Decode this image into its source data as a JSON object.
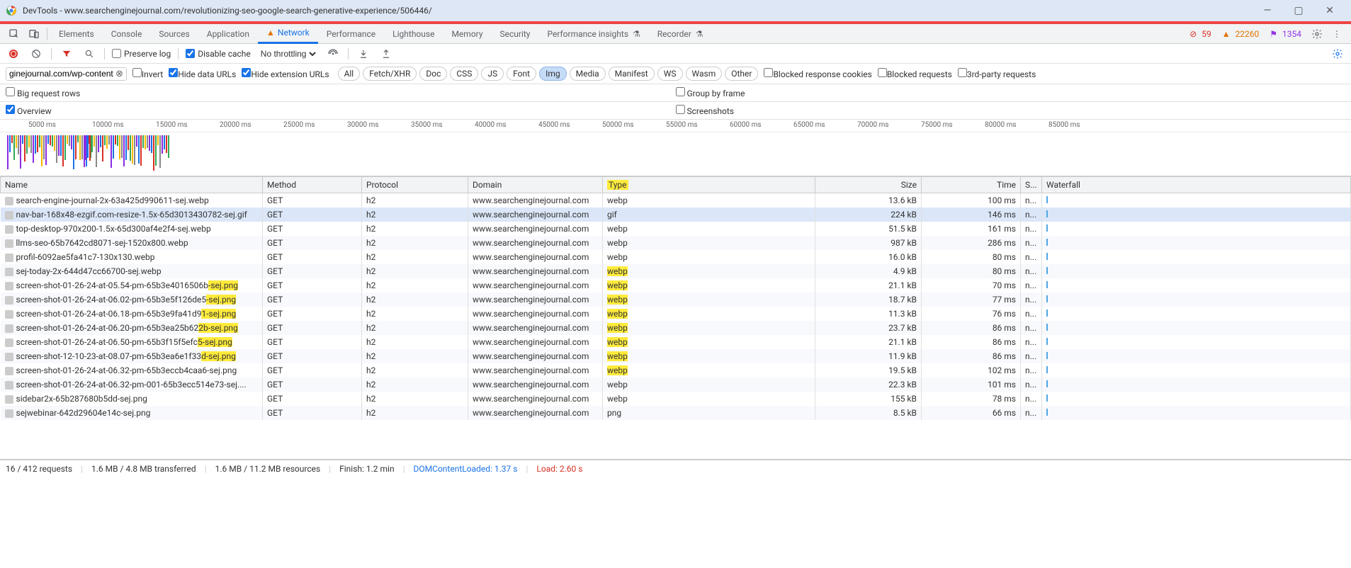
{
  "window": {
    "title": "DevTools - www.searchenginejournal.com/revolutionizing-seo-google-search-generative-experience/506446/"
  },
  "mainTabs": {
    "items": [
      "Elements",
      "Console",
      "Sources",
      "Application",
      "Network",
      "Performance",
      "Lighthouse",
      "Memory",
      "Security",
      "Performance insights",
      "Recorder"
    ],
    "active": "Network",
    "networkWarn": true
  },
  "counters": {
    "errors": "59",
    "warnings": "22260",
    "purple": "1354"
  },
  "toolbar": {
    "preserveLog": "Preserve log",
    "disableCache": "Disable cache",
    "throttling": "No throttling"
  },
  "filter": {
    "value": "ginejournal.com/wp-content",
    "invert": "Invert",
    "hideDataUrls": "Hide data URLs",
    "hideExtUrls": "Hide extension URLs",
    "types": [
      "All",
      "Fetch/XHR",
      "Doc",
      "CSS",
      "JS",
      "Font",
      "Img",
      "Media",
      "Manifest",
      "WS",
      "Wasm",
      "Other"
    ],
    "activeTypes": [
      "Img"
    ],
    "blockedCookies": "Blocked response cookies",
    "blockedRequests": "Blocked requests",
    "thirdParty": "3rd-party requests"
  },
  "options": {
    "bigRows": "Big request rows",
    "overview": "Overview",
    "groupFrame": "Group by frame",
    "screenshots": "Screenshots"
  },
  "timeline": {
    "ticks": [
      "5000 ms",
      "10000 ms",
      "15000 ms",
      "20000 ms",
      "25000 ms",
      "30000 ms",
      "35000 ms",
      "40000 ms",
      "45000 ms",
      "50000 ms",
      "55000 ms",
      "60000 ms",
      "65000 ms",
      "70000 ms",
      "75000 ms",
      "80000 ms",
      "85000 ms"
    ]
  },
  "columns": [
    "Name",
    "Method",
    "Protocol",
    "Domain",
    "Type",
    "Size",
    "Time",
    "S...",
    "Waterfall"
  ],
  "colHighlight": "Type",
  "rows": [
    {
      "name": "search-engine-journal-2x-63a425d990611-sej.webp",
      "method": "GET",
      "protocol": "h2",
      "domain": "www.searchenginejournal.com",
      "type": "webp",
      "size": "13.6 kB",
      "time": "100 ms",
      "status": "n...",
      "nameHl": "",
      "typeHl": false,
      "sel": false
    },
    {
      "name": "nav-bar-168x48-ezgif.com-resize-1.5x-65d3013430782-sej.gif",
      "method": "GET",
      "protocol": "h2",
      "domain": "www.searchenginejournal.com",
      "type": "gif",
      "size": "224 kB",
      "time": "146 ms",
      "status": "n...",
      "nameHl": "",
      "typeHl": false,
      "sel": true
    },
    {
      "name": "top-desktop-970x200-1.5x-65d300af4e2f4-sej.webp",
      "method": "GET",
      "protocol": "h2",
      "domain": "www.searchenginejournal.com",
      "type": "webp",
      "size": "51.5 kB",
      "time": "161 ms",
      "status": "n...",
      "nameHl": "",
      "typeHl": false,
      "sel": false
    },
    {
      "name": "llms-seo-65b7642cd8071-sej-1520x800.webp",
      "method": "GET",
      "protocol": "h2",
      "domain": "www.searchenginejournal.com",
      "type": "webp",
      "size": "987 kB",
      "time": "286 ms",
      "status": "n...",
      "nameHl": "",
      "typeHl": false,
      "sel": false
    },
    {
      "name": "profil-6092ae5fa41c7-130x130.webp",
      "method": "GET",
      "protocol": "h2",
      "domain": "www.searchenginejournal.com",
      "type": "webp",
      "size": "16.0 kB",
      "time": "80 ms",
      "status": "n...",
      "nameHl": "",
      "typeHl": false,
      "sel": false
    },
    {
      "name": "sej-today-2x-644d47cc66700-sej.webp",
      "method": "GET",
      "protocol": "h2",
      "domain": "www.searchenginejournal.com",
      "type": "webp",
      "size": "4.9 kB",
      "time": "80 ms",
      "status": "n...",
      "nameHl": "",
      "typeHl": true,
      "sel": false
    },
    {
      "name": "screen-shot-01-26-24-at-05.54-pm-65b3e4016506b",
      "nameHlSuffix": "-sej.png",
      "method": "GET",
      "protocol": "h2",
      "domain": "www.searchenginejournal.com",
      "type": "webp",
      "size": "21.1 kB",
      "time": "70 ms",
      "status": "n...",
      "typeHl": true,
      "sel": false
    },
    {
      "name": "screen-shot-01-26-24-at-06.02-pm-65b3e5f126de5",
      "nameHlSuffix": "-sej.png",
      "method": "GET",
      "protocol": "h2",
      "domain": "www.searchenginejournal.com",
      "type": "webp",
      "size": "18.7 kB",
      "time": "77 ms",
      "status": "n...",
      "typeHl": true,
      "sel": false
    },
    {
      "name": "screen-shot-01-26-24-at-06.18-pm-65b3e9fa41d9",
      "nameHlSuffix": "1-sej.png",
      "method": "GET",
      "protocol": "h2",
      "domain": "www.searchenginejournal.com",
      "type": "webp",
      "size": "11.3 kB",
      "time": "76 ms",
      "status": "n...",
      "typeHl": true,
      "sel": false
    },
    {
      "name": "screen-shot-01-26-24-at-06.20-pm-65b3ea25b62",
      "nameHlSuffix": "2b-sej.png",
      "method": "GET",
      "protocol": "h2",
      "domain": "www.searchenginejournal.com",
      "type": "webp",
      "size": "23.7 kB",
      "time": "86 ms",
      "status": "n...",
      "typeHl": true,
      "sel": false
    },
    {
      "name": "screen-shot-01-26-24-at-06.50-pm-65b3f15f5efc",
      "nameHlSuffix": "5-sej.png",
      "method": "GET",
      "protocol": "h2",
      "domain": "www.searchenginejournal.com",
      "type": "webp",
      "size": "21.1 kB",
      "time": "86 ms",
      "status": "n...",
      "typeHl": true,
      "sel": false
    },
    {
      "name": "screen-shot-12-10-23-at-08.07-pm-65b3ea6e1f33",
      "nameHlSuffix": "d-sej.png",
      "method": "GET",
      "protocol": "h2",
      "domain": "www.searchenginejournal.com",
      "type": "webp",
      "size": "11.9 kB",
      "time": "86 ms",
      "status": "n...",
      "typeHl": true,
      "sel": false
    },
    {
      "name": "screen-shot-01-26-24-at-06.32-pm-65b3eccb4caa6-sej.png",
      "method": "GET",
      "protocol": "h2",
      "domain": "www.searchenginejournal.com",
      "type": "webp",
      "size": "19.5 kB",
      "time": "102 ms",
      "status": "n...",
      "nameHl": "",
      "typeHl": true,
      "sel": false
    },
    {
      "name": "screen-shot-01-26-24-at-06.32-pm-001-65b3ecc514e73-sej....",
      "method": "GET",
      "protocol": "h2",
      "domain": "www.searchenginejournal.com",
      "type": "webp",
      "size": "22.3 kB",
      "time": "101 ms",
      "status": "n...",
      "nameHl": "",
      "typeHl": false,
      "sel": false
    },
    {
      "name": "sidebar2x-65b287680b5dd-sej.png",
      "method": "GET",
      "protocol": "h2",
      "domain": "www.searchenginejournal.com",
      "type": "webp",
      "size": "155 kB",
      "time": "78 ms",
      "status": "n...",
      "nameHl": "",
      "typeHl": false,
      "sel": false
    },
    {
      "name": "sejwebinar-642d29604e14c-sej.png",
      "method": "GET",
      "protocol": "h2",
      "domain": "www.searchenginejournal.com",
      "type": "png",
      "size": "8.5 kB",
      "time": "66 ms",
      "status": "n...",
      "nameHl": "",
      "typeHl": false,
      "sel": false
    }
  ],
  "status": {
    "requests": "16 / 412 requests",
    "transferred": "1.6 MB / 4.8 MB transferred",
    "resources": "1.6 MB / 11.2 MB resources",
    "finish": "Finish: 1.2 min",
    "dcl": "DOMContentLoaded: 1.37 s",
    "load": "Load: 2.60 s"
  }
}
